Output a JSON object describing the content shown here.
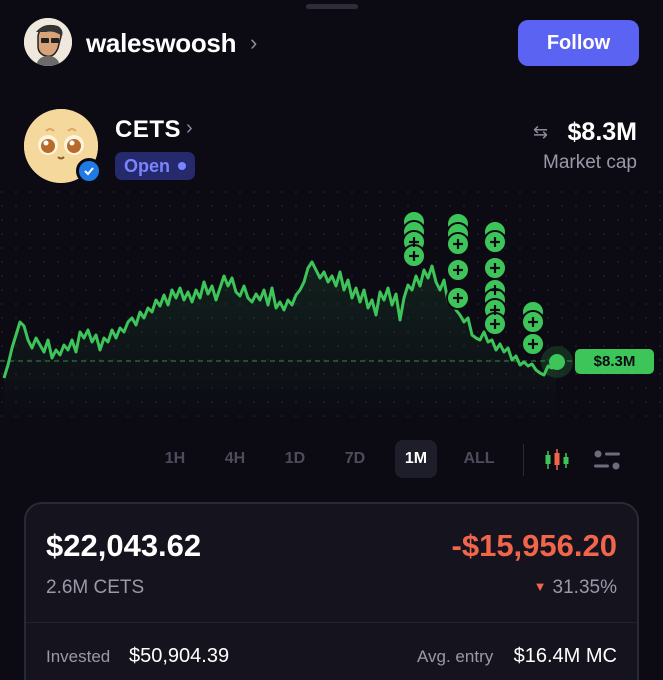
{
  "header": {
    "username": "waleswoosh",
    "follow_label": "Follow"
  },
  "token": {
    "name": "CETS",
    "status": "Open",
    "market_cap": "$8.3M",
    "market_cap_label": "Market cap",
    "current_price_tag": "$8.3M"
  },
  "timeframes": [
    "1H",
    "4H",
    "1D",
    "7D",
    "1M",
    "ALL"
  ],
  "active_timeframe": "1M",
  "position": {
    "value": "$22,043.62",
    "pnl": "-$15,956.20",
    "holdings": "2.6M CETS",
    "pnl_pct": "31.35%",
    "invested_label": "Invested",
    "invested_value": "$50,904.39",
    "avg_entry_label": "Avg. entry",
    "avg_entry_value": "$16.4M MC"
  },
  "colors": {
    "accent": "#5b64f2",
    "line_green": "#3ec55a",
    "loss_red": "#f2654b",
    "badge_bg": "#242a6b",
    "badge_text": "#7b84ff"
  },
  "icons": {
    "swap": "swap-arrows-icon",
    "chevron": "chevron-right-icon",
    "verified": "verified-check-icon",
    "buy_marker": "plus-circle-icon",
    "candles": "candlestick-icon",
    "settings": "sliders-icon"
  }
}
